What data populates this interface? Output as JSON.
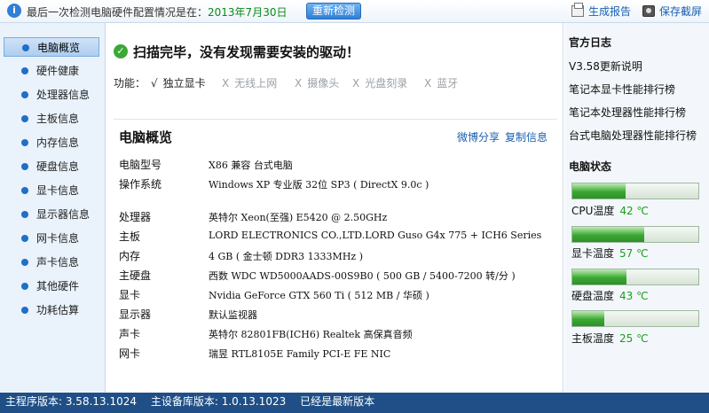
{
  "top_bar": {
    "info_icon": "info-icon",
    "last_check_text": "最后一次检测电脑硬件配置情况是在：",
    "last_check_date": "2013年7月30日",
    "redetect_label": "重新检测",
    "generate_report_label": "生成报告",
    "save_screenshot_label": "保存截屏"
  },
  "sidebar": {
    "items": [
      {
        "label": "电脑概览",
        "active": true
      },
      {
        "label": "硬件健康"
      },
      {
        "label": "处理器信息"
      },
      {
        "label": "主板信息"
      },
      {
        "label": "内存信息"
      },
      {
        "label": "硬盘信息"
      },
      {
        "label": "显卡信息"
      },
      {
        "label": "显示器信息"
      },
      {
        "label": "网卡信息"
      },
      {
        "label": "声卡信息"
      },
      {
        "label": "其他硬件"
      },
      {
        "label": "功耗估算"
      }
    ]
  },
  "main": {
    "scan_message": "扫描完毕，没有发现需要安装的驱动！",
    "functions_label": "功能：",
    "functions": [
      {
        "mark": "√",
        "label": "独立显卡",
        "available": true
      },
      {
        "mark": "X",
        "label": "无线上网",
        "available": false
      },
      {
        "mark": "X",
        "label": "摄像头",
        "available": false
      },
      {
        "mark": "X",
        "label": "光盘刻录",
        "available": false
      },
      {
        "mark": "X",
        "label": "蓝牙",
        "available": false
      }
    ],
    "overview_title": "电脑概览",
    "share_link": "微博分享",
    "copy_link": "复制信息",
    "rows": [
      {
        "label": "电脑型号",
        "value": "X86 兼容 台式电脑"
      },
      {
        "label": "操作系统",
        "value": "Windows XP 专业版 32位 SP3 ( DirectX 9.0c )"
      },
      {
        "label": "处理器",
        "value": "英特尔 Xeon(至强) E5420 @ 2.50GHz"
      },
      {
        "label": "主板",
        "value": "LORD ELECTRONICS CO.,LTD.LORD Guso G4x 775 + ICH6 Series (..."
      },
      {
        "label": "内存",
        "value": "4 GB ( 金士顿 DDR3 1333MHz )"
      },
      {
        "label": "主硬盘",
        "value": "西数 WDC WD5000AADS-00S9B0 ( 500 GB / 5400-7200 转/分 )"
      },
      {
        "label": "显卡",
        "value": "Nvidia GeForce GTX 560 Ti ( 512 MB / 华硕 )"
      },
      {
        "label": "显示器",
        "value": "默认监视器"
      },
      {
        "label": "声卡",
        "value": "英特尔 82801FB(ICH6) Realtek 高保真音频"
      },
      {
        "label": "网卡",
        "value": "瑞昱 RTL8105E Family PCI-E FE NIC"
      }
    ]
  },
  "right_panel": {
    "log_title": "官方日志",
    "log_links": [
      "V3.58更新说明",
      "笔记本显卡性能排行榜",
      "笔记本处理器性能排行榜",
      "台式电脑处理器性能排行榜"
    ],
    "status_title": "电脑状态",
    "temps": [
      {
        "label": "CPU温度",
        "value": "42 ℃",
        "level": 0.42
      },
      {
        "label": "显卡温度",
        "value": "57 ℃",
        "level": 0.57
      },
      {
        "label": "硬盘温度",
        "value": "43 ℃",
        "level": 0.43
      },
      {
        "label": "主板温度",
        "value": "25 ℃",
        "level": 0.25
      }
    ],
    "temp_color": "#3aa932"
  },
  "status_bar": {
    "program_version": "主程序版本: 3.58.13.1024",
    "device_db_version": "主设备库版本: 1.0.13.1023",
    "status": "已经是最新版本"
  }
}
